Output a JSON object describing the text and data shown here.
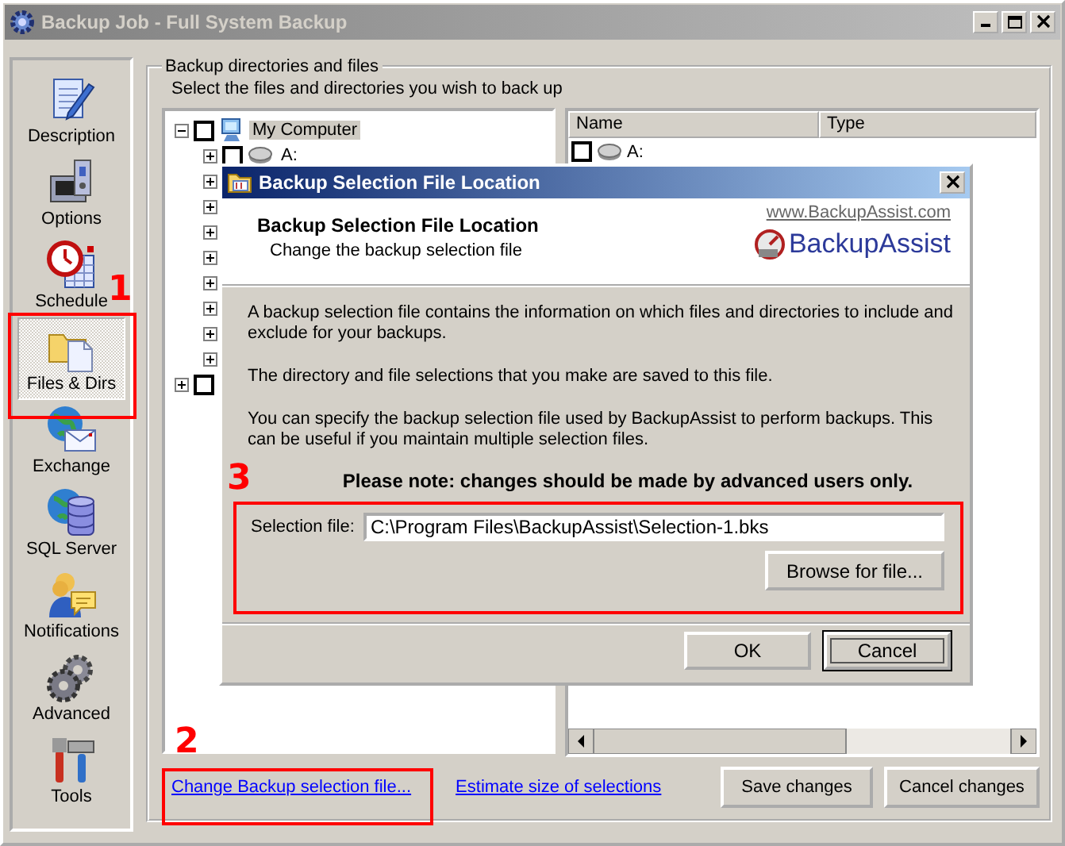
{
  "window": {
    "title": "Backup Job - Full System Backup"
  },
  "sidebar": {
    "items": [
      {
        "label": "Description",
        "selected": false
      },
      {
        "label": "Options",
        "selected": false
      },
      {
        "label": "Schedule",
        "selected": false
      },
      {
        "label": "Files & Dirs",
        "selected": true
      },
      {
        "label": "Exchange",
        "selected": false
      },
      {
        "label": "SQL Server",
        "selected": false
      },
      {
        "label": "Notifications",
        "selected": false
      },
      {
        "label": "Advanced",
        "selected": false
      },
      {
        "label": "Tools",
        "selected": false
      }
    ]
  },
  "group": {
    "title": "Backup directories and files",
    "instruction": "Select the files and directories you wish to back up"
  },
  "tree": {
    "items": [
      {
        "label": "My Computer",
        "expanded": true,
        "checked": false,
        "selected": true,
        "children": [
          {
            "label": "A:",
            "expanded": false,
            "checked": false
          },
          {
            "expanded": false
          },
          {
            "expanded": false
          },
          {
            "expanded": false
          },
          {
            "expanded": false
          },
          {
            "expanded": false
          },
          {
            "expanded": false
          },
          {
            "expanded": false
          },
          {
            "expanded": false
          }
        ]
      },
      {
        "expanded": false,
        "checked": false
      }
    ]
  },
  "file_list": {
    "columns": [
      "Name",
      "Type"
    ],
    "rows": [
      {
        "name": "A:",
        "checked": false
      }
    ]
  },
  "links": [
    "Change Backup selection file...",
    "Estimate size of selections"
  ],
  "buttons": [
    "Save changes",
    "Cancel changes"
  ],
  "dialog": {
    "title": "Backup Selection File Location",
    "heading": "Backup Selection File Location",
    "subheading": "Change the backup selection file",
    "website": "www.BackupAssist.com",
    "logo_text": "BackupAssist",
    "paragraphs": [
      "A backup selection file contains the information on which files and directories to include and exclude for your backups.",
      "The directory and file selections that you make are saved to this file.",
      "You can specify the backup selection file used by BackupAssist to perform backups. This can be useful if you maintain multiple selection files."
    ],
    "note": "Please note: changes should be made by advanced users only.",
    "selection_file": {
      "label": "Selection file:",
      "value": "C:\\Program Files\\BackupAssist\\Selection-1.bks"
    },
    "browse_button": "Browse for file...",
    "buttons": [
      {
        "label": "OK",
        "default": false
      },
      {
        "label": "Cancel",
        "default": true
      }
    ]
  },
  "annotations": [
    {
      "label": "1"
    },
    {
      "label": "2"
    },
    {
      "label": "3"
    }
  ]
}
